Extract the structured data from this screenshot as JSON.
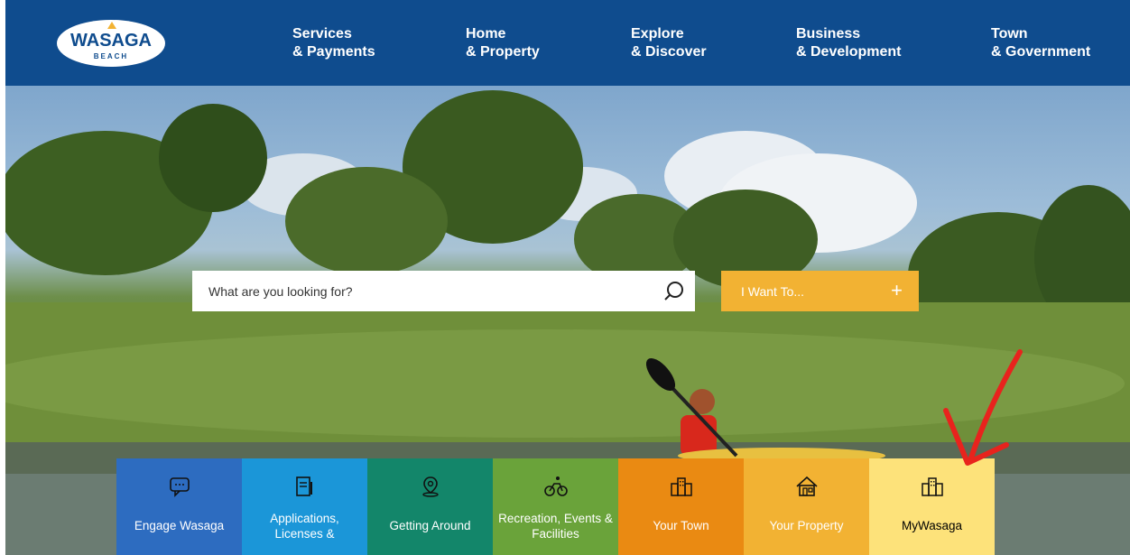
{
  "header": {
    "logo": {
      "name": "WASAGA",
      "sub": "BEACH"
    },
    "nav": [
      {
        "line1": "Services",
        "line2": "& Payments"
      },
      {
        "line1": "Home",
        "line2": "& Property"
      },
      {
        "line1": "Explore",
        "line2": "& Discover"
      },
      {
        "line1": "Business",
        "line2": "& Development"
      },
      {
        "line1": "Town",
        "line2": "& Government"
      }
    ]
  },
  "search": {
    "placeholder": "What are you looking for?",
    "icon": "search-icon"
  },
  "i_want": {
    "label": "I Want To...",
    "icon": "plus-icon"
  },
  "tiles": [
    {
      "label": "Engage Wasaga",
      "icon": "chat-bubble-icon"
    },
    {
      "label": "Applications, Licenses &",
      "icon": "document-pen-icon"
    },
    {
      "label": "Getting Around",
      "icon": "map-pin-icon"
    },
    {
      "label": "Recreation, Events & Facilities",
      "icon": "bicycle-icon"
    },
    {
      "label": "Your Town",
      "icon": "buildings-icon"
    },
    {
      "label": "Your Property",
      "icon": "house-icon"
    },
    {
      "label": "MyWasaga",
      "icon": "buildings-icon"
    }
  ],
  "colors": {
    "header": "#0f4c8e",
    "accent": "#f2b233",
    "annotation_arrow": "#e8231d"
  }
}
